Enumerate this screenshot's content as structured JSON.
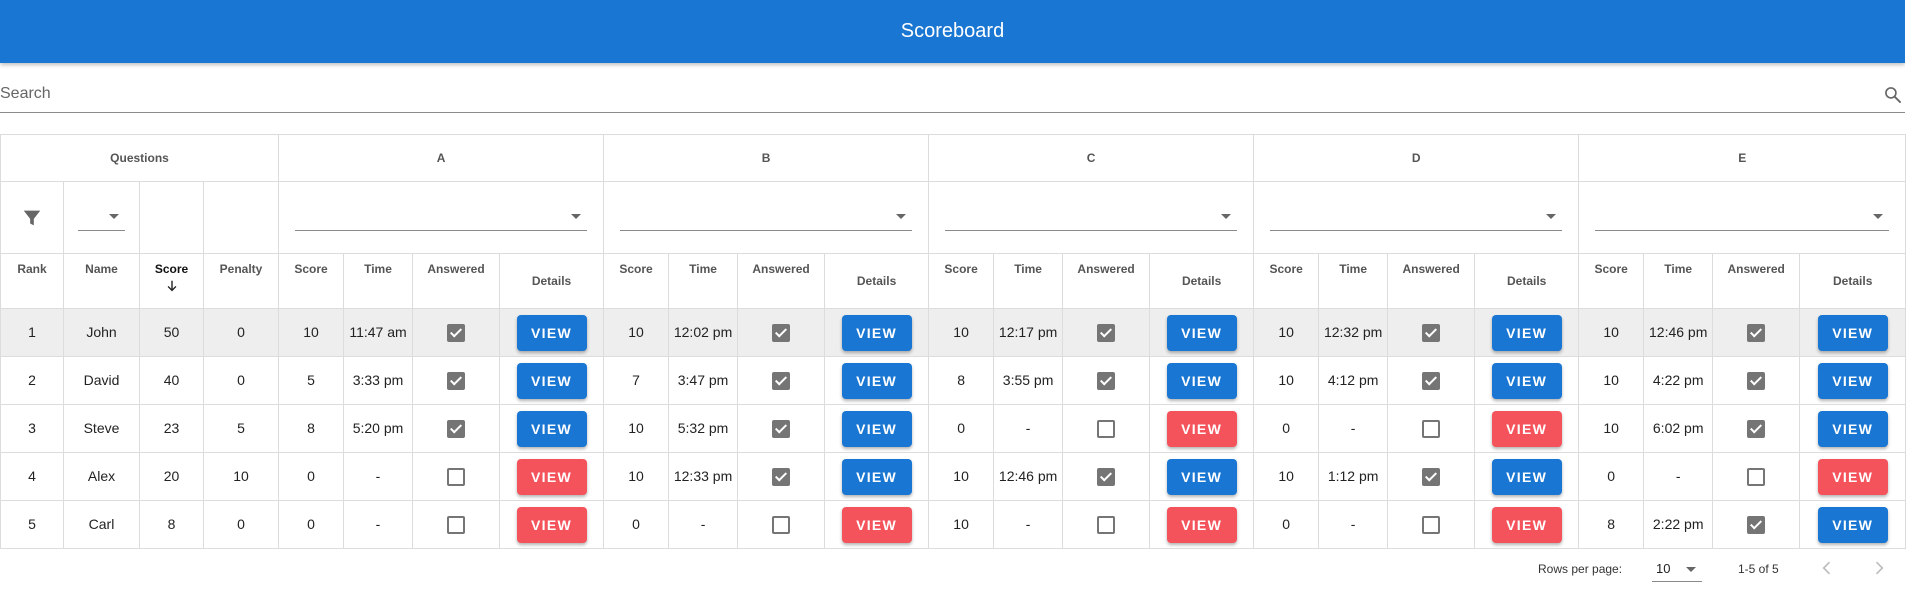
{
  "appbar": {
    "title": "Scoreboard"
  },
  "search": {
    "placeholder": "Search"
  },
  "header": {
    "questions_label": "Questions",
    "questions": [
      "A",
      "B",
      "C",
      "D",
      "E"
    ],
    "base_columns": {
      "rank": "Rank",
      "name": "Name",
      "score": "Score",
      "penalty": "Penalty"
    },
    "question_columns": {
      "score": "Score",
      "time": "Time",
      "answered": "Answered",
      "details": "Details"
    }
  },
  "rows": [
    {
      "rank": "1",
      "name": "John",
      "score": "50",
      "penalty": "0",
      "highlight": true,
      "questions": [
        {
          "score": "10",
          "time": "11:47 am",
          "answered": true,
          "view": "VIEW",
          "status": "ok"
        },
        {
          "score": "10",
          "time": "12:02 pm",
          "answered": true,
          "view": "VIEW",
          "status": "ok"
        },
        {
          "score": "10",
          "time": "12:17 pm",
          "answered": true,
          "view": "VIEW",
          "status": "ok"
        },
        {
          "score": "10",
          "time": "12:32 pm",
          "answered": true,
          "view": "VIEW",
          "status": "ok"
        },
        {
          "score": "10",
          "time": "12:46 pm",
          "answered": true,
          "view": "VIEW",
          "status": "ok"
        }
      ]
    },
    {
      "rank": "2",
      "name": "David",
      "score": "40",
      "penalty": "0",
      "highlight": false,
      "questions": [
        {
          "score": "5",
          "time": "3:33 pm",
          "answered": true,
          "view": "VIEW",
          "status": "ok"
        },
        {
          "score": "7",
          "time": "3:47 pm",
          "answered": true,
          "view": "VIEW",
          "status": "ok"
        },
        {
          "score": "8",
          "time": "3:55 pm",
          "answered": true,
          "view": "VIEW",
          "status": "ok"
        },
        {
          "score": "10",
          "time": "4:12 pm",
          "answered": true,
          "view": "VIEW",
          "status": "ok"
        },
        {
          "score": "10",
          "time": "4:22 pm",
          "answered": true,
          "view": "VIEW",
          "status": "ok"
        }
      ]
    },
    {
      "rank": "3",
      "name": "Steve",
      "score": "23",
      "penalty": "5",
      "highlight": false,
      "questions": [
        {
          "score": "8",
          "time": "5:20 pm",
          "answered": true,
          "view": "VIEW",
          "status": "ok"
        },
        {
          "score": "10",
          "time": "5:32 pm",
          "answered": true,
          "view": "VIEW",
          "status": "ok"
        },
        {
          "score": "0",
          "time": "-",
          "answered": false,
          "view": "VIEW",
          "status": "missing"
        },
        {
          "score": "0",
          "time": "-",
          "answered": false,
          "view": "VIEW",
          "status": "missing"
        },
        {
          "score": "10",
          "time": "6:02 pm",
          "answered": true,
          "view": "VIEW",
          "status": "ok"
        }
      ]
    },
    {
      "rank": "4",
      "name": "Alex",
      "score": "20",
      "penalty": "10",
      "highlight": false,
      "questions": [
        {
          "score": "0",
          "time": "-",
          "answered": false,
          "view": "VIEW",
          "status": "missing"
        },
        {
          "score": "10",
          "time": "12:33 pm",
          "answered": true,
          "view": "VIEW",
          "status": "ok"
        },
        {
          "score": "10",
          "time": "12:46 pm",
          "answered": true,
          "view": "VIEW",
          "status": "ok"
        },
        {
          "score": "10",
          "time": "1:12 pm",
          "answered": true,
          "view": "VIEW",
          "status": "ok"
        },
        {
          "score": "0",
          "time": "-",
          "answered": false,
          "view": "VIEW",
          "status": "missing"
        }
      ]
    },
    {
      "rank": "5",
      "name": "Carl",
      "score": "8",
      "penalty": "0",
      "highlight": false,
      "questions": [
        {
          "score": "0",
          "time": "-",
          "answered": false,
          "view": "VIEW",
          "status": "missing"
        },
        {
          "score": "0",
          "time": "-",
          "answered": false,
          "view": "VIEW",
          "status": "missing"
        },
        {
          "score": "10",
          "time": "-",
          "answered": false,
          "view": "VIEW",
          "status": "missing"
        },
        {
          "score": "0",
          "time": "-",
          "answered": false,
          "view": "VIEW",
          "status": "missing"
        },
        {
          "score": "8",
          "time": "2:22 pm",
          "answered": true,
          "view": "VIEW",
          "status": "ok"
        }
      ]
    }
  ],
  "footer": {
    "rows_per_page_label": "Rows per page:",
    "rows_per_page_value": "10",
    "range": "1-5 of 5"
  },
  "colors": {
    "primary": "#1976d2",
    "danger": "#f5535c",
    "checkbox": "#757575",
    "row_highlight": "#eeeeee"
  },
  "icons": {
    "search": "search-icon",
    "filter": "filter-icon",
    "sort": "arrow-down-icon",
    "prev": "chevron-left-icon",
    "next": "chevron-right-icon",
    "dropdown": "caret-down-icon"
  }
}
